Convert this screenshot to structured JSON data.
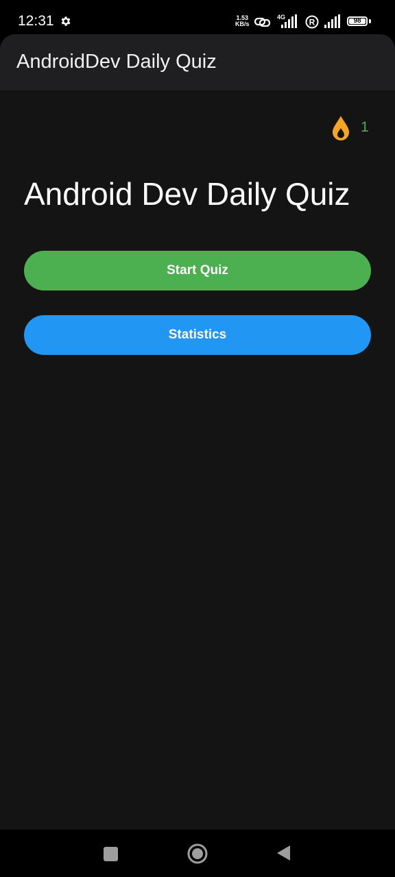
{
  "status_bar": {
    "time": "12:31",
    "net_speed_value": "1.53",
    "net_speed_unit": "KB/s",
    "network_type": "4G",
    "battery_level": "98",
    "icons": [
      "settings-icon",
      "link-icon",
      "signal-icon",
      "roaming-icon",
      "signal-icon",
      "battery-icon"
    ]
  },
  "app_bar": {
    "title": "AndroidDev Daily Quiz"
  },
  "streak": {
    "icon": "flame-icon",
    "count": "1",
    "icon_color": "#f5a623",
    "count_color": "#4caf50"
  },
  "main": {
    "title": "Android Dev Daily Quiz",
    "start_button_label": "Start Quiz",
    "statistics_button_label": "Statistics",
    "start_button_color": "#4caf50",
    "statistics_button_color": "#2196f3"
  },
  "nav_bar": {
    "icons": [
      "recents-icon",
      "home-icon",
      "back-icon"
    ]
  }
}
